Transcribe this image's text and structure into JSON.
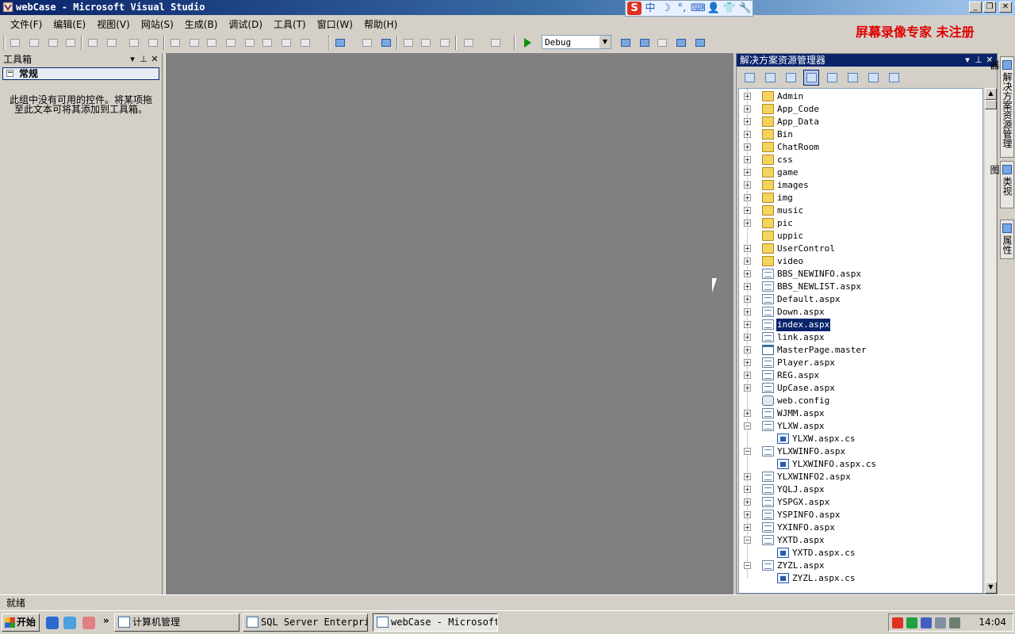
{
  "window": {
    "title": "webCase - Microsoft Visual Studio"
  },
  "ime": {
    "items": [
      "S",
      "中",
      "☽",
      "°,",
      "⌨",
      "👤",
      "👕",
      "🔧"
    ]
  },
  "menu": [
    "文件(F)",
    "编辑(E)",
    "视图(V)",
    "网站(S)",
    "生成(B)",
    "调试(D)",
    "工具(T)",
    "窗口(W)",
    "帮助(H)"
  ],
  "watermark": "屏幕录像专家  未注册",
  "toolbar": {
    "configuration": "Debug"
  },
  "toolbox": {
    "title": "工具箱",
    "category": "常规",
    "empty_message": "此组中没有可用的控件。将某项拖至此文本可将其添加到工具箱。"
  },
  "solution_explorer": {
    "title": "解决方案资源管理器",
    "items": [
      {
        "label": "Admin",
        "icon": "folder",
        "expander": "+"
      },
      {
        "label": "App_Code",
        "icon": "folder",
        "expander": "+"
      },
      {
        "label": "App_Data",
        "icon": "special",
        "expander": "+"
      },
      {
        "label": "Bin",
        "icon": "special",
        "expander": "+"
      },
      {
        "label": "ChatRoom",
        "icon": "folder",
        "expander": "+"
      },
      {
        "label": "css",
        "icon": "folder",
        "expander": "+"
      },
      {
        "label": "game",
        "icon": "folder",
        "expander": "+"
      },
      {
        "label": "images",
        "icon": "folder",
        "expander": "+"
      },
      {
        "label": "img",
        "icon": "folder",
        "expander": "+"
      },
      {
        "label": "music",
        "icon": "folder",
        "expander": "+"
      },
      {
        "label": "pic",
        "icon": "folder",
        "expander": "+"
      },
      {
        "label": "uppic",
        "icon": "folder",
        "expander": ""
      },
      {
        "label": "UserControl",
        "icon": "folder",
        "expander": "+"
      },
      {
        "label": "video",
        "icon": "folder",
        "expander": "+"
      },
      {
        "label": "BBS_NEWINFO.aspx",
        "icon": "page",
        "expander": "+"
      },
      {
        "label": "BBS_NEWLIST.aspx",
        "icon": "page",
        "expander": "+"
      },
      {
        "label": "Default.aspx",
        "icon": "page",
        "expander": "+"
      },
      {
        "label": "Down.aspx",
        "icon": "page",
        "expander": "+"
      },
      {
        "label": "index.aspx",
        "icon": "page",
        "expander": "+",
        "selected": true
      },
      {
        "label": "link.aspx",
        "icon": "page",
        "expander": "+"
      },
      {
        "label": "MasterPage.master",
        "icon": "master",
        "expander": "+"
      },
      {
        "label": "Player.aspx",
        "icon": "page",
        "expander": "+"
      },
      {
        "label": "REG.aspx",
        "icon": "page",
        "expander": "+"
      },
      {
        "label": "UpCase.aspx",
        "icon": "page",
        "expander": "+"
      },
      {
        "label": "web.config",
        "icon": "config",
        "expander": ""
      },
      {
        "label": "WJMM.aspx",
        "icon": "page",
        "expander": "+"
      },
      {
        "label": "YLXW.aspx",
        "icon": "page",
        "expander": "−"
      },
      {
        "label": "YLXW.aspx.cs",
        "icon": "cs",
        "expander": "",
        "child": true
      },
      {
        "label": "YLXWINFO.aspx",
        "icon": "page",
        "expander": "−"
      },
      {
        "label": "YLXWINFO.aspx.cs",
        "icon": "cs",
        "expander": "",
        "child": true
      },
      {
        "label": "YLXWINFO2.aspx",
        "icon": "page",
        "expander": "+"
      },
      {
        "label": "YQLJ.aspx",
        "icon": "page",
        "expander": "+"
      },
      {
        "label": "YSPGX.aspx",
        "icon": "page",
        "expander": "+"
      },
      {
        "label": "YSPINFO.aspx",
        "icon": "page",
        "expander": "+"
      },
      {
        "label": "YXINFO.aspx",
        "icon": "page",
        "expander": "+"
      },
      {
        "label": "YXTD.aspx",
        "icon": "page",
        "expander": "−"
      },
      {
        "label": "YXTD.aspx.cs",
        "icon": "cs",
        "expander": "",
        "child": true
      },
      {
        "label": "ZYZL.aspx",
        "icon": "page",
        "expander": "−"
      },
      {
        "label": "ZYZL.aspx.cs",
        "icon": "cs",
        "expander": "",
        "child": true
      }
    ]
  },
  "side_tabs": [
    "解决方案资源管理器",
    "类视图",
    "属性"
  ],
  "status": {
    "text": "就绪"
  },
  "taskbar": {
    "start": "开始",
    "tasks": [
      "计算机管理",
      "SQL Server Enterpri...",
      "webCase - Microsoft..."
    ],
    "clock": "14:04"
  },
  "colors": {
    "title_active": "#0a246a",
    "workspace": "#808080",
    "watermark": "#e00000"
  }
}
